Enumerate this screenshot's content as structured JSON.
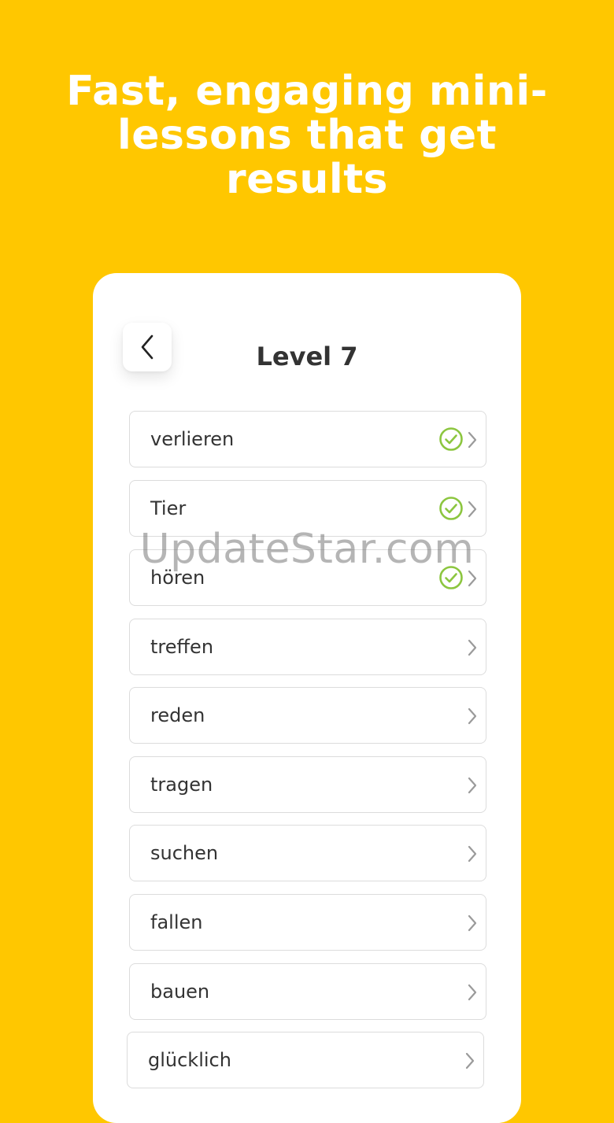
{
  "headline": "Fast, engaging mini-lessons that get results",
  "card": {
    "title": "Level 7",
    "items": [
      {
        "label": "verlieren",
        "done": true
      },
      {
        "label": "Tier",
        "done": true
      },
      {
        "label": "hören",
        "done": true
      },
      {
        "label": "treffen",
        "done": false
      },
      {
        "label": "reden",
        "done": false
      },
      {
        "label": "tragen",
        "done": false
      },
      {
        "label": "suchen",
        "done": false
      },
      {
        "label": "fallen",
        "done": false
      },
      {
        "label": "bauen",
        "done": false
      },
      {
        "label": "glücklich",
        "done": false
      }
    ]
  },
  "watermark": "UpdateStar.com",
  "colors": {
    "background": "#FFC700",
    "card": "#FFFFFF",
    "text": "#333333",
    "check": "#8CC63F",
    "chevron": "#9A9A9A",
    "row_border": "#DCDCDC"
  },
  "icons": {
    "back": "chevron-left-icon",
    "done": "check-circle-icon",
    "row_arrow": "chevron-right-icon"
  }
}
